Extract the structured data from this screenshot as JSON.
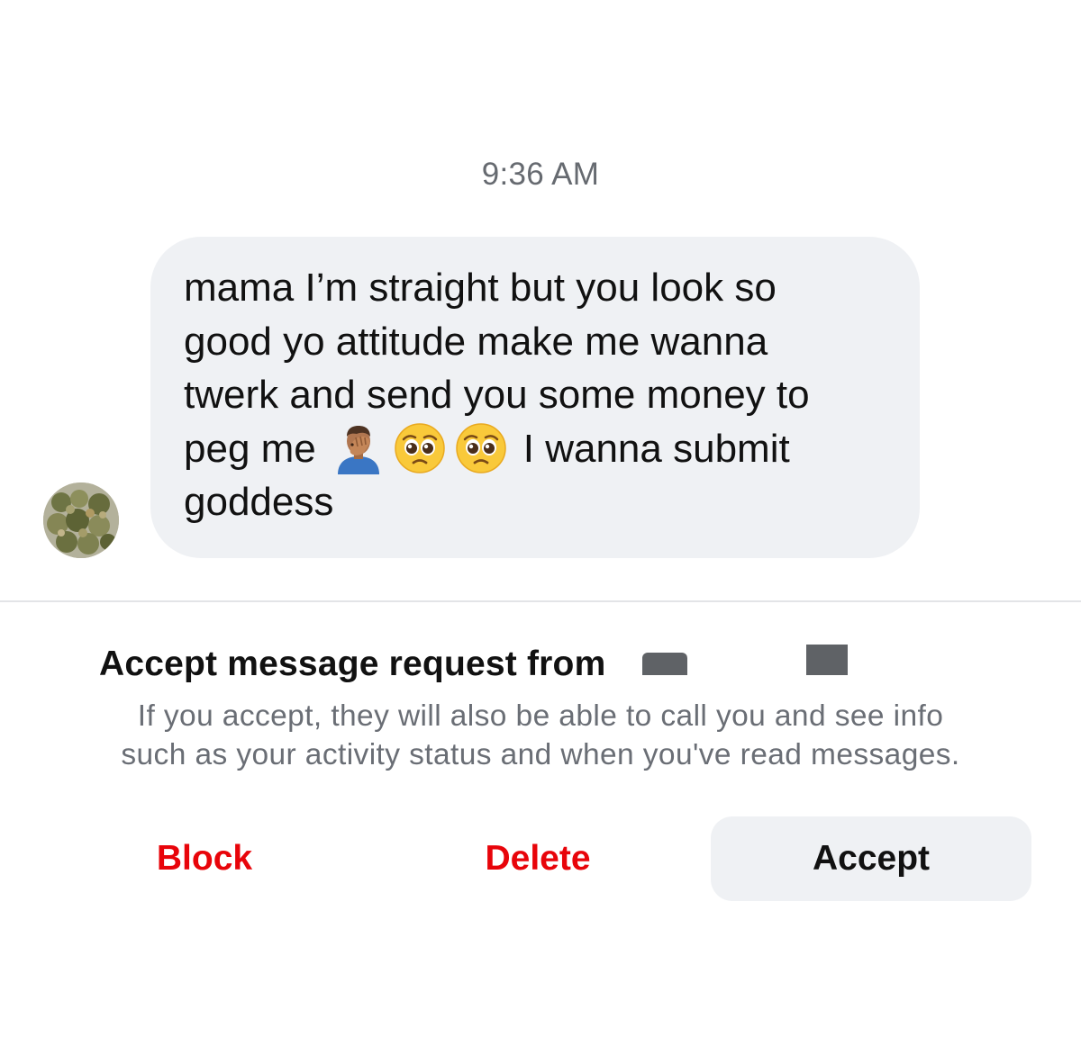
{
  "conversation": {
    "timestamp": "9:36 AM",
    "message": {
      "lines": [
        "mama I’m straight but you look so",
        "good yo attitude make me wanna",
        "twerk and send you some money to",
        "peg me",
        "I wanna submit",
        "goddess"
      ],
      "emojis": [
        "facepalm-emoji",
        "pleading-face-emoji",
        "pleading-face-emoji"
      ]
    },
    "sender_avatar": "profile-avatar"
  },
  "request_panel": {
    "title": "Accept message request from",
    "description_lines": [
      "If you accept, they will also be able to call you and see info",
      "such as your activity status and when you've read messages."
    ],
    "buttons": {
      "block": "Block",
      "delete": "Delete",
      "accept": "Accept"
    }
  },
  "colors": {
    "destructive": "#e8040a",
    "bubble_background": "#eff1f4",
    "secondary_text": "#6a6e75"
  }
}
